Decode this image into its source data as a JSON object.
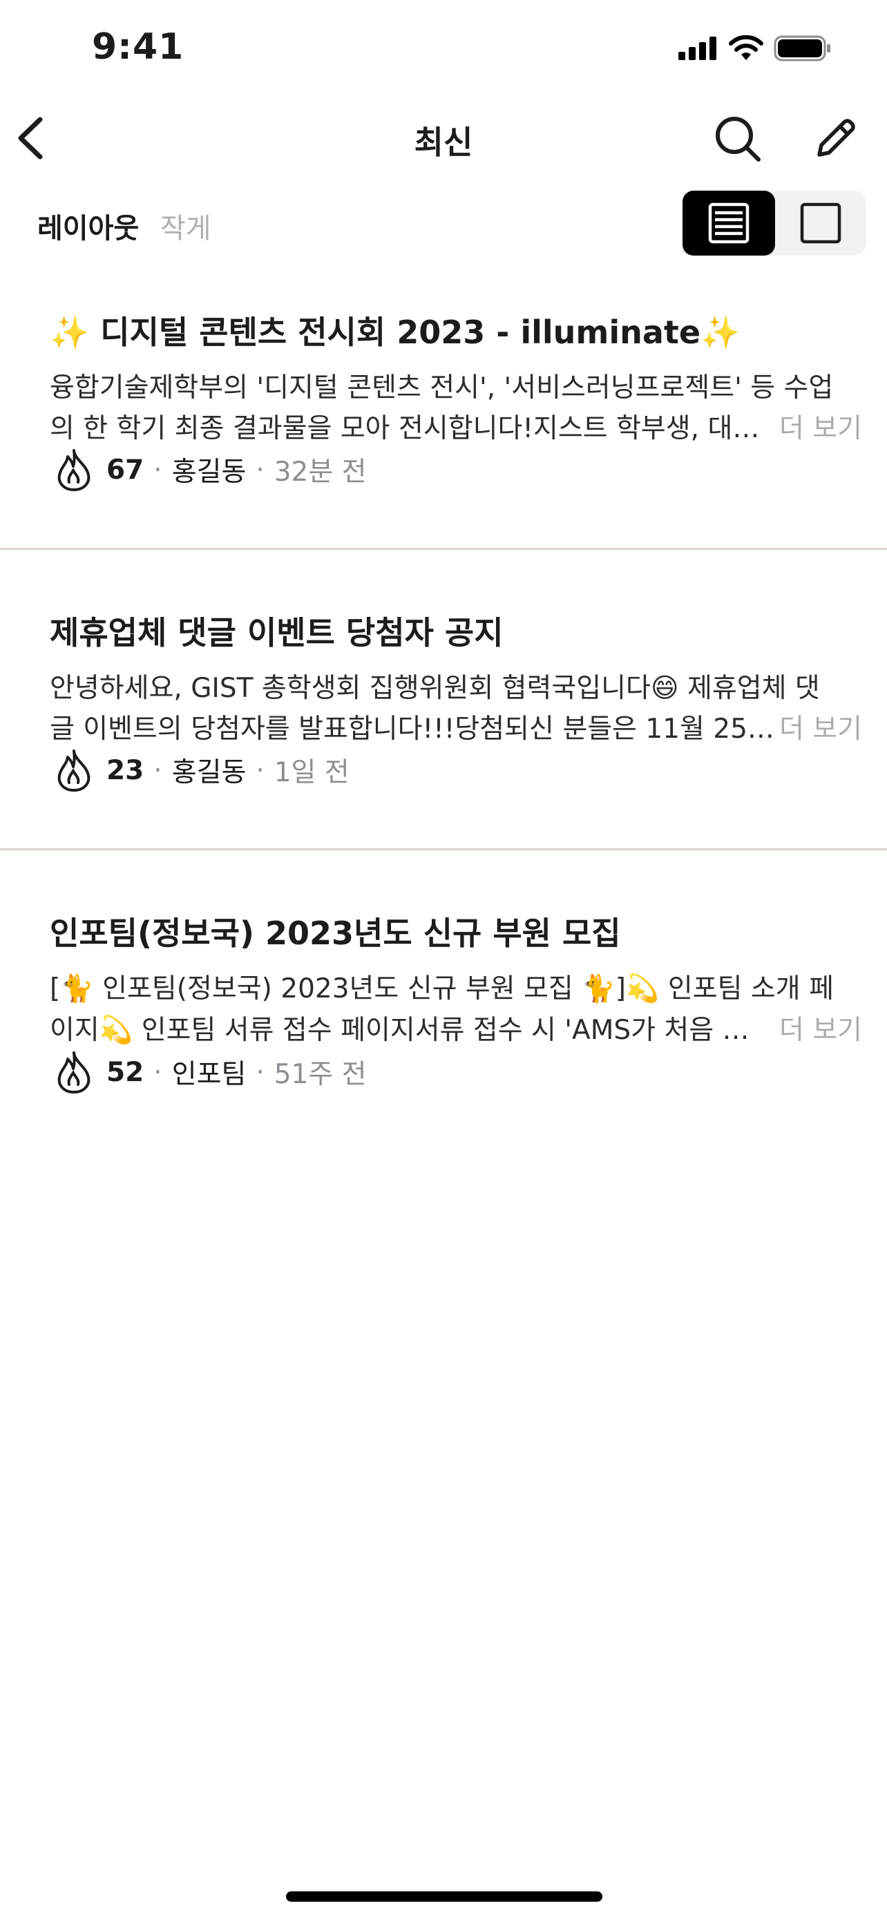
{
  "status_bar": {
    "time": "9:41"
  },
  "nav": {
    "title": "최신"
  },
  "layout": {
    "label": "레이아웃",
    "value": "작게"
  },
  "posts": [
    {
      "title": "✨  디지털 콘텐츠 전시회 2023 - illuminate✨",
      "body_line1": "융합기술제학부의 '디지털 콘텐츠 전시', '서비스러닝프로젝트' 등 수업",
      "body_line2": "의 한 학기 최종 결과물을 모아 전시합니다!지스트 학부생, 대…",
      "more": "더 보기",
      "likes": "67",
      "separator": "·",
      "author": "홍길동",
      "time": "32분 전"
    },
    {
      "title": "제휴업체 댓글 이벤트 당첨자 공지",
      "body_line1": "안녕하세요, GIST 총학생회 집행위원회 협력국입니다😄 제휴업체 댓",
      "body_line2": "글 이벤트의 당첨자를 발표합니다!!!당첨되신 분들은 11월 25…",
      "more": "더 보기",
      "likes": "23",
      "separator": "·",
      "author": "홍길동",
      "time": "1일 전"
    },
    {
      "title": "인포팀(정보국) 2023년도 신규 부원 모집",
      "body_line1": "[🐈 인포팀(정보국) 2023년도 신규 부원 모집 🐈]💫  인포팀 소개 페",
      "body_line2": "이지💫  인포팀 서류 접수 페이지서류 접수 시 'AMS가 처음  …",
      "more": "더 보기",
      "likes": "52",
      "separator": "·",
      "author": "인포팀",
      "time": "51주 전"
    }
  ],
  "icons": {
    "back": "chevron-left-icon",
    "search": "search-icon",
    "edit": "pencil-icon",
    "list_view": "list-view-icon",
    "card_view": "card-view-icon",
    "like": "flame-icon"
  },
  "colors": {
    "accent": "#000000",
    "muted": "#8e8e93",
    "divider": "#ddd6cf"
  }
}
